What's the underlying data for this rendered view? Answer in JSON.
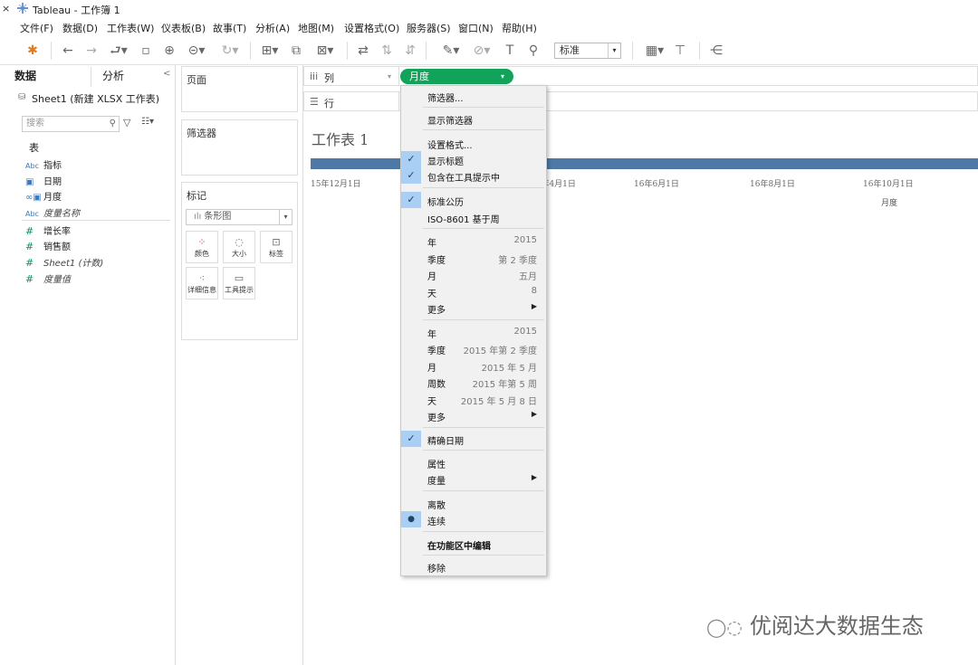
{
  "app": {
    "title": "Tableau - 工作簿 1"
  },
  "menubar": [
    "文件(F)",
    "数据(D)",
    "工作表(W)",
    "仪表板(B)",
    "故事(T)",
    "分析(A)",
    "地图(M)",
    "设置格式(O)",
    "服务器(S)",
    "窗口(N)",
    "帮助(H)"
  ],
  "toolbar": {
    "fit_select": "标准"
  },
  "datapane": {
    "tab_data": "数据",
    "tab_analysis": "分析",
    "source": "Sheet1 (新建 XLSX 工作表)",
    "search_placeholder": "搜索",
    "table_header": "表",
    "dimensions": [
      {
        "icon": "Abc",
        "name": "指标"
      },
      {
        "icon": "cal-icon",
        "name": "日期"
      },
      {
        "icon": "cal-link-icon",
        "name": "月度"
      },
      {
        "icon": "Abc",
        "name": "度量名称"
      }
    ],
    "measures": [
      {
        "icon": "#",
        "name": "增长率"
      },
      {
        "icon": "#",
        "name": "销售额"
      },
      {
        "icon": "#",
        "name": "Sheet1 (计数)"
      },
      {
        "icon": "#",
        "name": "度量值"
      }
    ]
  },
  "cards": {
    "pages": "页面",
    "filters": "筛选器",
    "marks": "标记",
    "mark_type": "条形图",
    "mark_buttons": [
      "颜色",
      "大小",
      "标签",
      "详细信息",
      "工具提示"
    ]
  },
  "shelves": {
    "columns": "列",
    "rows": "行",
    "pill": "月度"
  },
  "worksheet": {
    "title": "工作表 1",
    "ticks": [
      "15年12月1日",
      "16年4月1日",
      "16年6月1日",
      "16年8月1日",
      "16年10月1日"
    ],
    "axis_label": "月度"
  },
  "context_menu": {
    "filter": "筛选器...",
    "show_filter": "显示筛选器",
    "format": "设置格式...",
    "show_header": "显示标题",
    "include_tooltip": "包含在工具提示中",
    "std_calendar": "标准公历",
    "iso_week": "ISO-8601 基于周",
    "parts": [
      {
        "label": "年",
        "value": "2015"
      },
      {
        "label": "季度",
        "value": "第 2 季度"
      },
      {
        "label": "月",
        "value": "五月"
      },
      {
        "label": "天",
        "value": "8"
      },
      {
        "label": "更多",
        "value": ""
      }
    ],
    "values": [
      {
        "label": "年",
        "value": "2015"
      },
      {
        "label": "季度",
        "value": "2015 年第 2 季度"
      },
      {
        "label": "月",
        "value": "2015 年 5 月"
      },
      {
        "label": "周数",
        "value": "2015 年第 5 周"
      },
      {
        "label": "天",
        "value": "2015 年 5 月 8 日"
      },
      {
        "label": "更多",
        "value": ""
      }
    ],
    "exact_date": "精确日期",
    "attribute": "属性",
    "measure": "度量",
    "discrete": "离散",
    "continuous": "连续",
    "edit_shelf": "在功能区中编辑",
    "remove": "移除"
  },
  "watermark": "优阅达大数据生态"
}
